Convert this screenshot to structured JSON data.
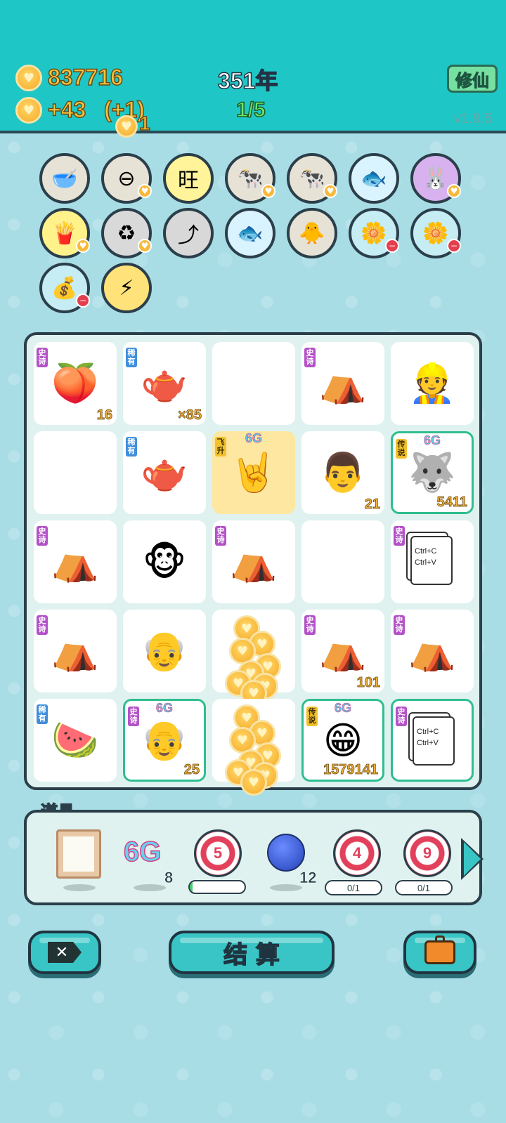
{
  "header": {
    "coins": "837716",
    "income": "+43",
    "income_bonus": "(+1)",
    "floating_coin_text": "1",
    "year": "351年",
    "round": "1/5",
    "xiuxian_label": "修仙",
    "version": "v1.9.5"
  },
  "relics": [
    {
      "icon": "dog-food-bowl-icon",
      "glyph": "🥣",
      "badge": ""
    },
    {
      "icon": "no-entry-icon",
      "glyph": "⊖",
      "badge": "heart"
    },
    {
      "icon": "wang-characters-icon",
      "glyph": "旺",
      "badge": ""
    },
    {
      "icon": "cow-pair-icon",
      "glyph": "🐄",
      "badge": "heart"
    },
    {
      "icon": "cow-pair-icon",
      "glyph": "🐄",
      "badge": "heart"
    },
    {
      "icon": "fish-bowl-icon",
      "glyph": "🐟",
      "badge": ""
    },
    {
      "icon": "bunny-icon",
      "glyph": "🐰",
      "badge": "heart"
    },
    {
      "icon": "french-fries-icon",
      "glyph": "🍟",
      "badge": "heart"
    },
    {
      "icon": "recycle-arrows-icon",
      "glyph": "♻",
      "badge": "heart"
    },
    {
      "icon": "arrow-up-card-icon",
      "glyph": "⤴",
      "badge": ""
    },
    {
      "icon": "fish-bowl-icon",
      "glyph": "🐟",
      "badge": ""
    },
    {
      "icon": "chick-egg-icon",
      "glyph": "🐥",
      "badge": ""
    },
    {
      "icon": "potted-flower-icon",
      "glyph": "🌼",
      "badge": "minus"
    },
    {
      "icon": "potted-flower-icon",
      "glyph": "🌼",
      "badge": "minus"
    },
    {
      "icon": "money-bag-icon",
      "glyph": "💰",
      "badge": "minus"
    },
    {
      "icon": "lightning-icon",
      "glyph": "⚡",
      "badge": ""
    }
  ],
  "board": [
    [
      {
        "icon": "peach-icon",
        "glyph": "🍑",
        "tag": "史诗",
        "tagType": "epic",
        "num": "16"
      },
      {
        "icon": "teapot-icon",
        "glyph": "🫖",
        "tag": "稀有",
        "tagType": "rare",
        "num": "×85"
      },
      {
        "icon": "",
        "glyph": "",
        "tag": "",
        "tagType": "",
        "num": ""
      },
      {
        "icon": "bunny-tent-icon",
        "glyph": "⛺",
        "tag": "史诗",
        "tagType": "epic",
        "num": ""
      },
      {
        "icon": "delivery-man-icon",
        "glyph": "👷",
        "tag": "",
        "tagType": "",
        "num": ""
      }
    ],
    [
      {
        "icon": "",
        "glyph": "",
        "tag": "",
        "tagType": "",
        "num": ""
      },
      {
        "icon": "teapot-icon",
        "glyph": "🫖",
        "tag": "稀有",
        "tagType": "rare",
        "num": ""
      },
      {
        "icon": "rock-hand-icon",
        "glyph": "🤘",
        "tag": "飞升",
        "tagType": "fly",
        "num": "",
        "sixg": "6G",
        "yellow": true
      },
      {
        "icon": "man-face-icon",
        "glyph": "👨",
        "tag": "",
        "tagType": "",
        "num": "21"
      },
      {
        "icon": "husky-king-icon",
        "glyph": "🐺",
        "tag": "传说",
        "tagType": "legend",
        "num": "5411",
        "sixg": "6G",
        "hl": true
      }
    ],
    [
      {
        "icon": "bunny-tent-icon",
        "glyph": "⛺",
        "tag": "史诗",
        "tagType": "epic",
        "num": ""
      },
      {
        "icon": "monkey-glasses-icon",
        "glyph": "🐵",
        "tag": "",
        "tagType": "",
        "num": ""
      },
      {
        "icon": "bunny-tent-icon",
        "glyph": "⛺",
        "tag": "史诗",
        "tagType": "epic",
        "num": ""
      },
      {
        "icon": "",
        "glyph": "",
        "tag": "",
        "tagType": "",
        "num": ""
      },
      {
        "icon": "copy-paste-icon",
        "glyph": "⧉",
        "tag": "史诗",
        "tagType": "epic",
        "num": "",
        "cp": true
      }
    ],
    [
      {
        "icon": "bunny-tent-icon",
        "glyph": "⛺",
        "tag": "史诗",
        "tagType": "epic",
        "num": ""
      },
      {
        "icon": "old-man-glasses-icon",
        "glyph": "👴",
        "tag": "",
        "tagType": "",
        "num": ""
      },
      {
        "icon": "coin-pile-icon",
        "glyph": "",
        "tag": "",
        "tagType": "",
        "num": "",
        "coins": true
      },
      {
        "icon": "bunny-tent-icon",
        "glyph": "⛺",
        "tag": "史诗",
        "tagType": "epic",
        "num": "101"
      },
      {
        "icon": "bunny-tent-icon",
        "glyph": "⛺",
        "tag": "史诗",
        "tagType": "epic",
        "num": ""
      }
    ],
    [
      {
        "icon": "watermelon-icon",
        "glyph": "🍉",
        "tag": "稀有",
        "tagType": "rare",
        "num": ""
      },
      {
        "icon": "king-old-man-icon",
        "glyph": "👴",
        "tag": "史诗",
        "tagType": "epic",
        "num": "25",
        "sixg": "6G",
        "hl": true
      },
      {
        "icon": "coin-pile-icon",
        "glyph": "",
        "tag": "",
        "tagType": "",
        "num": "",
        "coins": true
      },
      {
        "icon": "king-smiling-man-icon",
        "glyph": "😁",
        "tag": "传说",
        "tagType": "legend",
        "num": "1579141",
        "sixg": "6G",
        "hl": true
      },
      {
        "icon": "copy-paste-icon",
        "glyph": "⧉",
        "tag": "史诗",
        "tagType": "epic",
        "num": "",
        "cp": true,
        "hl": true
      }
    ]
  ],
  "copy_paste_text": [
    "Ctrl+C",
    "Ctrl+V"
  ],
  "props": {
    "title": "道具",
    "items": [
      {
        "icon": "frame-icon",
        "label": "",
        "count": ""
      },
      {
        "icon": "6g-icon",
        "label": "6G",
        "count": "8"
      },
      {
        "icon": "target-icon",
        "label": "5",
        "count": "",
        "progress": 0.05
      },
      {
        "icon": "blueberry-icon",
        "label": "",
        "count": "12"
      },
      {
        "icon": "target-icon",
        "label": "4",
        "count": "",
        "pill": "0/1"
      },
      {
        "icon": "target-icon",
        "label": "9",
        "count": "",
        "pill": "0/1"
      }
    ]
  },
  "buttons": {
    "close_icon": "close-tag-icon",
    "settle_label": "结 算",
    "bag_icon": "briefcase-icon"
  },
  "colors": {
    "header_bg": "#1fc6c6",
    "page_bg": "#a9dde6",
    "border": "#2b3f4a",
    "gold": "#f7c33b",
    "epic": "#b452c8",
    "rare": "#3f8edc",
    "legend": "#f2c12b"
  }
}
